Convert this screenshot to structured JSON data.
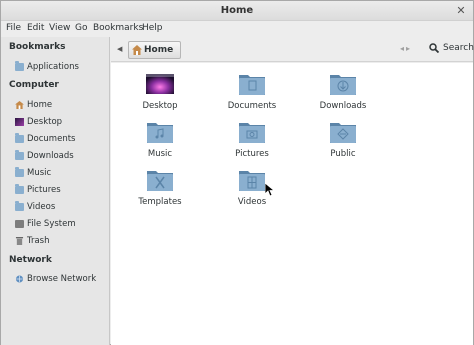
{
  "window": {
    "title": "Home"
  },
  "menubar": [
    "File",
    "Edit",
    "View",
    "Go",
    "Bookmarks",
    "Help"
  ],
  "sidebar": {
    "bookmarks_head": "Bookmarks",
    "bookmarks": [
      {
        "label": "Applications",
        "icon": "folder-icon"
      }
    ],
    "computer_head": "Computer",
    "computer": [
      {
        "label": "Home",
        "icon": "home-icon"
      },
      {
        "label": "Desktop",
        "icon": "desktop-icon"
      },
      {
        "label": "Documents",
        "icon": "folder-icon"
      },
      {
        "label": "Downloads",
        "icon": "folder-icon"
      },
      {
        "label": "Music",
        "icon": "folder-icon"
      },
      {
        "label": "Pictures",
        "icon": "folder-icon"
      },
      {
        "label": "Videos",
        "icon": "folder-icon"
      },
      {
        "label": "File System",
        "icon": "drive-icon"
      },
      {
        "label": "Trash",
        "icon": "trash-icon"
      }
    ],
    "network_head": "Network",
    "network": [
      {
        "label": "Browse Network",
        "icon": "network-icon"
      }
    ]
  },
  "toolbar": {
    "path_label": "Home",
    "search_label": "Search"
  },
  "files": [
    {
      "label": "Desktop",
      "icon": "desktop-icon"
    },
    {
      "label": "Documents",
      "icon": "documents-folder-icon"
    },
    {
      "label": "Downloads",
      "icon": "downloads-folder-icon"
    },
    {
      "label": "Music",
      "icon": "music-folder-icon"
    },
    {
      "label": "Pictures",
      "icon": "pictures-folder-icon"
    },
    {
      "label": "Public",
      "icon": "public-folder-icon"
    },
    {
      "label": "Templates",
      "icon": "templates-folder-icon"
    },
    {
      "label": "Videos",
      "icon": "videos-folder-icon"
    }
  ],
  "colors": {
    "folder": "#8aafcf",
    "folder_dark": "#5b84a8",
    "sidebar_bg": "#e6e6e6",
    "content_bg": "#ffffff"
  }
}
